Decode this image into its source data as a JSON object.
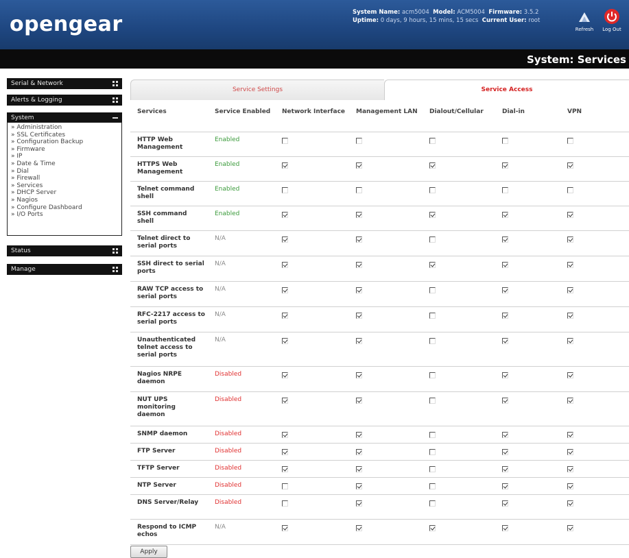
{
  "header": {
    "logo": "opengear",
    "system_name_label": "System Name:",
    "system_name": "acm5004",
    "model_label": "Model:",
    "model": "ACM5004",
    "firmware_label": "Firmware:",
    "firmware": "3.5.2",
    "uptime_label": "Uptime:",
    "uptime": "0 days, 9 hours, 15 mins, 15 secs",
    "current_user_label": "Current User:",
    "current_user": "root",
    "refresh_label": "Refresh",
    "logout_label": "Log Out"
  },
  "page_title": "System: Services",
  "sidebar": {
    "sections": [
      {
        "label": "Serial & Network"
      },
      {
        "label": "Alerts & Logging"
      },
      {
        "label": "System"
      },
      {
        "label": "Status"
      },
      {
        "label": "Manage"
      }
    ],
    "system_items": [
      "» Administration",
      "» SSL Certificates",
      "» Configuration Backup",
      "» Firmware",
      "» IP",
      "» Date & Time",
      "» Dial",
      "» Firewall",
      "» Services",
      "» DHCP Server",
      "» Nagios",
      "» Configure Dashboard",
      "» I/O Ports"
    ]
  },
  "tabs": {
    "settings": "Service Settings",
    "access": "Service Access"
  },
  "table": {
    "headers": [
      "Services",
      "Service Enabled",
      "Network Interface",
      "Management LAN",
      "Dialout/Cellular",
      "Dial-in",
      "VPN"
    ],
    "rows": [
      {
        "service": "HTTP Web Management",
        "status": "Enabled",
        "checks": [
          false,
          false,
          false,
          false,
          false
        ]
      },
      {
        "service": "HTTPS Web Management",
        "status": "Enabled",
        "checks": [
          true,
          true,
          true,
          true,
          true
        ]
      },
      {
        "service": "Telnet command shell",
        "status": "Enabled",
        "checks": [
          false,
          false,
          false,
          false,
          false
        ]
      },
      {
        "service": "SSH command shell",
        "status": "Enabled",
        "checks": [
          true,
          true,
          true,
          true,
          true
        ]
      },
      {
        "service": "Telnet direct to serial ports",
        "status": "N/A",
        "checks": [
          true,
          true,
          false,
          true,
          true
        ]
      },
      {
        "service": "SSH direct to serial ports",
        "status": "N/A",
        "checks": [
          true,
          true,
          true,
          true,
          true
        ]
      },
      {
        "service": "RAW TCP access to serial ports",
        "status": "N/A",
        "checks": [
          true,
          true,
          false,
          true,
          true
        ]
      },
      {
        "service": "RFC-2217 access to serial ports",
        "status": "N/A",
        "checks": [
          true,
          true,
          false,
          true,
          true
        ]
      },
      {
        "service": "Unauthenticated telnet access to serial ports",
        "status": "N/A",
        "checks": [
          true,
          true,
          false,
          true,
          true
        ]
      },
      {
        "service": "Nagios NRPE daemon",
        "status": "Disabled",
        "checks": [
          true,
          true,
          false,
          true,
          true
        ]
      },
      {
        "service": "NUT UPS monitoring daemon",
        "status": "Disabled",
        "checks": [
          true,
          true,
          false,
          true,
          true
        ]
      },
      {
        "service": "SNMP daemon",
        "status": "Disabled",
        "checks": [
          true,
          true,
          false,
          true,
          true
        ]
      },
      {
        "service": "FTP Server",
        "status": "Disabled",
        "checks": [
          true,
          true,
          false,
          true,
          true
        ]
      },
      {
        "service": "TFTP Server",
        "status": "Disabled",
        "checks": [
          true,
          true,
          false,
          true,
          true
        ]
      },
      {
        "service": "NTP Server",
        "status": "Disabled",
        "checks": [
          false,
          true,
          false,
          true,
          true
        ]
      },
      {
        "service": "DNS Server/Relay",
        "status": "Disabled",
        "checks": [
          false,
          true,
          false,
          true,
          true
        ]
      },
      {
        "service": "Respond to ICMP echos",
        "status": "N/A",
        "checks": [
          true,
          true,
          true,
          true,
          true
        ]
      }
    ]
  },
  "apply_label": "Apply",
  "colors": {
    "header_blue": "#1e4680",
    "enabled_green": "#3a9a3a",
    "disabled_red": "#e03030",
    "tab_active_red": "#d42020"
  }
}
